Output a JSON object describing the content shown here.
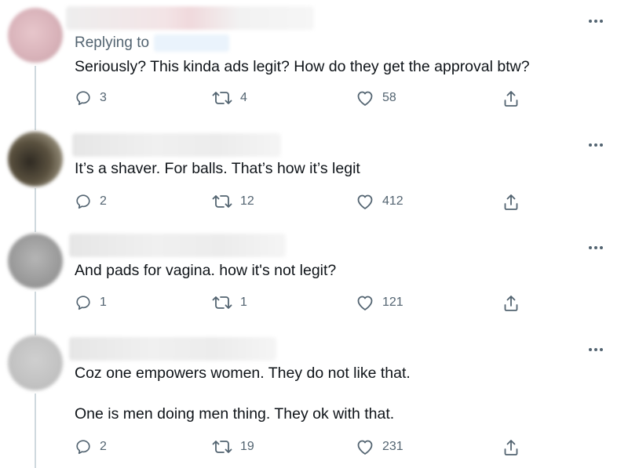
{
  "colors": {
    "text": "#0f1419",
    "secondary": "#536471",
    "thread_line": "#cfd9de"
  },
  "icons": {
    "reply": "reply-icon",
    "retweet": "retweet-icon",
    "like": "like-icon",
    "share": "share-icon",
    "more": "more-icon"
  },
  "replying_to_label": "Replying to",
  "tweets": [
    {
      "text_lines": [
        "Seriously? This kinda ads legit? How do they get the approval btw?"
      ],
      "replies": "3",
      "retweets": "4",
      "likes": "58"
    },
    {
      "text_lines": [
        "It’s a shaver. For balls. That’s how it’s legit"
      ],
      "replies": "2",
      "retweets": "12",
      "likes": "412"
    },
    {
      "text_lines": [
        "And pads for vagina. how it's not legit?"
      ],
      "replies": "1",
      "retweets": "1",
      "likes": "121"
    },
    {
      "text_lines": [
        "Coz one empowers women. They do not like that.",
        "One is men doing men thing. They ok with that."
      ],
      "replies": "2",
      "retweets": "19",
      "likes": "231"
    }
  ]
}
